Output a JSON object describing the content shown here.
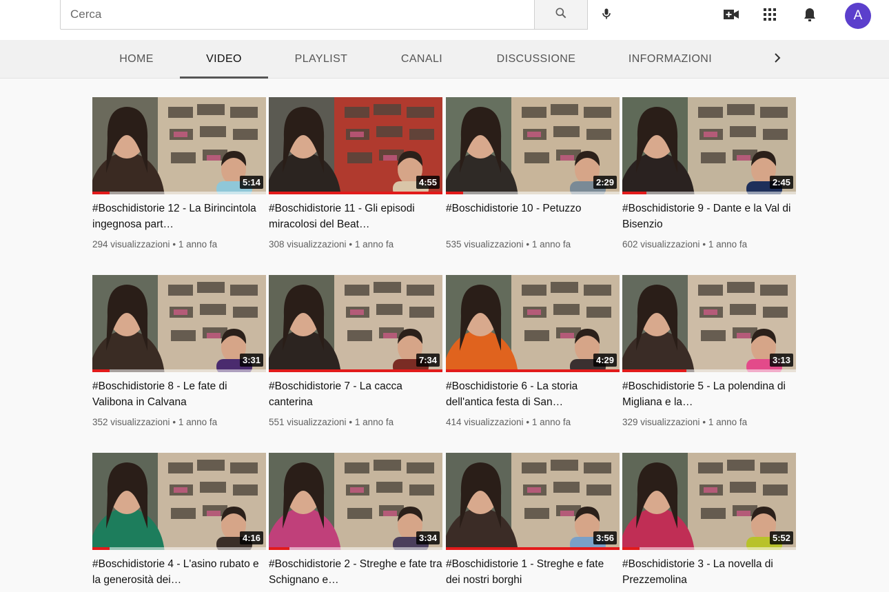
{
  "search": {
    "placeholder": "Cerca"
  },
  "header": {
    "icons": [
      "search-icon",
      "mic-icon",
      "create-video-icon",
      "apps-grid-icon",
      "notifications-bell-icon"
    ],
    "avatar_initial": "A",
    "avatar_color": "#5b3fcc"
  },
  "tabs": [
    {
      "label": "HOME"
    },
    {
      "label": "VIDEO"
    },
    {
      "label": "PLAYLIST"
    },
    {
      "label": "CANALI"
    },
    {
      "label": "DISCUSSIONE"
    },
    {
      "label": "INFORMAZIONI"
    }
  ],
  "active_tab": "VIDEO",
  "videos": [
    {
      "title": "#Boschidistorie 12 - La Birincintola ingegnosa part…",
      "views": "294 visualizzazioni",
      "age": "1 anno fa",
      "duration": "5:14",
      "watched": 0.1
    },
    {
      "title": "#Boschidistorie 11 - Gli episodi miracolosi del Beat…",
      "views": "308 visualizzazioni",
      "age": "1 anno fa",
      "duration": "4:55",
      "watched": 1.0
    },
    {
      "title": "#Boschidistorie 10 - Petuzzo",
      "views": "535 visualizzazioni",
      "age": "1 anno fa",
      "duration": "2:29",
      "watched": 0.1
    },
    {
      "title": "#Boschidistorie 9 - Dante e la Val di Bisenzio",
      "views": "602 visualizzazioni",
      "age": "1 anno fa",
      "duration": "2:45",
      "watched": 0.14
    },
    {
      "title": "#Boschidistorie 8 - Le fate di Valibona in Calvana",
      "views": "352 visualizzazioni",
      "age": "1 anno fa",
      "duration": "3:31",
      "watched": 0.1
    },
    {
      "title": "#Boschidistorie 7 - La cacca canterina",
      "views": "551 visualizzazioni",
      "age": "1 anno fa",
      "duration": "7:34",
      "watched": 1.0
    },
    {
      "title": "#Boschidistorie 6 - La storia dell'antica festa di San…",
      "views": "414 visualizzazioni",
      "age": "1 anno fa",
      "duration": "4:29",
      "watched": 1.0
    },
    {
      "title": "#Boschidistorie 5 - La polendina di Migliana e la…",
      "views": "329 visualizzazioni",
      "age": "1 anno fa",
      "duration": "3:13",
      "watched": 0.37
    },
    {
      "title": "#Boschidistorie 4 - L'asino rubato e la generosità dei…",
      "views": "",
      "age": "",
      "duration": "4:16",
      "watched": 0.1
    },
    {
      "title": "#Boschidistorie 2 - Streghe e fate tra Schignano e…",
      "views": "",
      "age": "",
      "duration": "3:34",
      "watched": 0.12
    },
    {
      "title": "#Boschidistorie 1 - Streghe e fate dei nostri borghi",
      "views": "",
      "age": "",
      "duration": "3:56",
      "watched": 1.0
    },
    {
      "title": "#Boschidistorie 3 - La novella di Prezzemolina",
      "views": "",
      "age": "",
      "duration": "5:52",
      "watched": 0.1
    }
  ],
  "meta_separator": "•",
  "colors": {
    "progress": "#e21b1b",
    "avatar": "#5b3fcc"
  }
}
